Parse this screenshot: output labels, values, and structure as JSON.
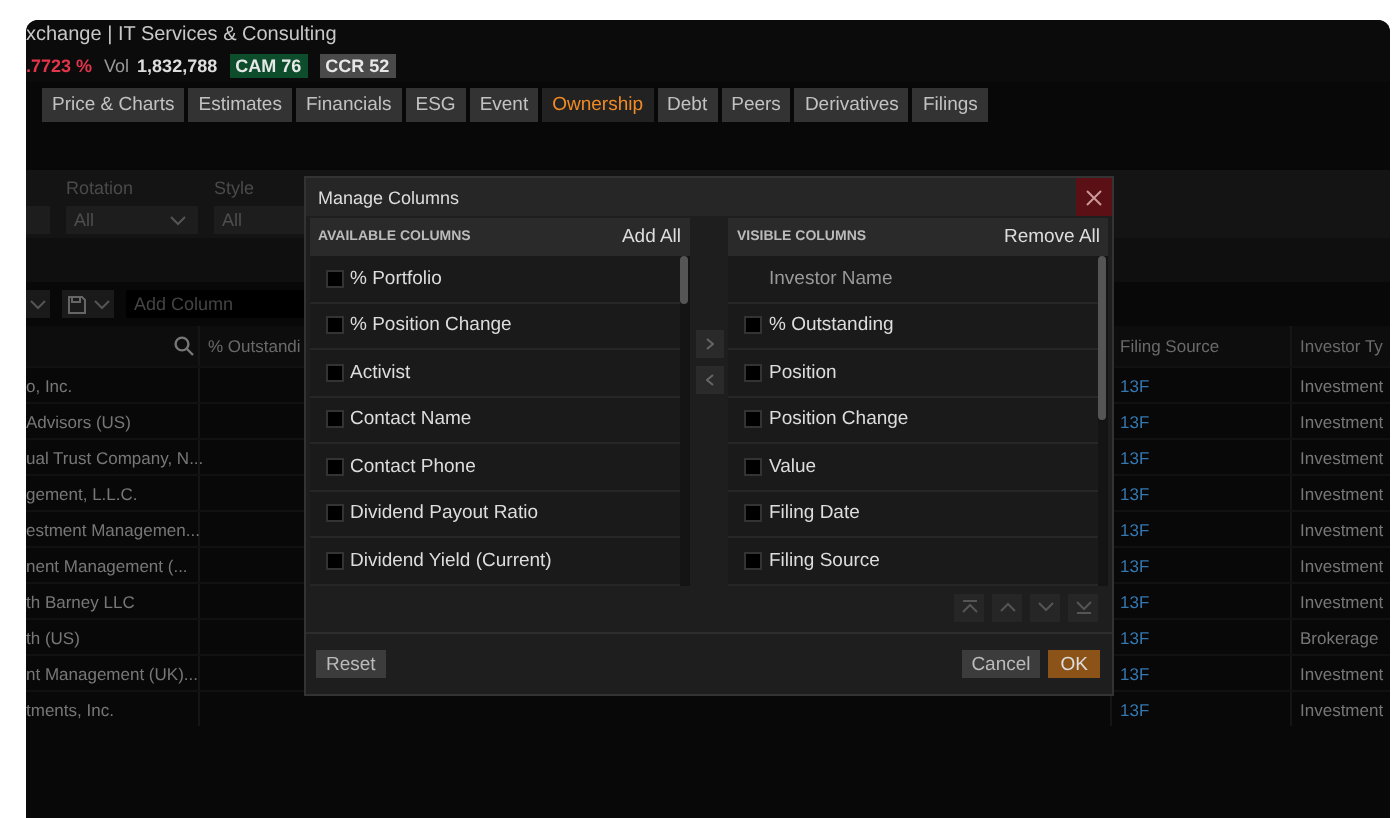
{
  "header": {
    "subtitle": "xchange | IT Services & Consulting",
    "change": ".7723 %",
    "volume_label": "Vol",
    "volume": "1,832,788",
    "badges": [
      {
        "label": "CAM 76",
        "color": "#0e4d2c"
      },
      {
        "label": "CCR 52",
        "color": "#4a4a4a"
      }
    ]
  },
  "tabs": [
    {
      "label": "Price & Charts",
      "selected": false
    },
    {
      "label": "Estimates",
      "selected": false
    },
    {
      "label": "Financials",
      "selected": false
    },
    {
      "label": "ESG",
      "selected": false
    },
    {
      "label": "Event",
      "selected": false
    },
    {
      "label": "Ownership",
      "selected": true
    },
    {
      "label": "Debt",
      "selected": false
    },
    {
      "label": "Peers",
      "selected": false
    },
    {
      "label": "Derivatives",
      "selected": false
    },
    {
      "label": "Filings",
      "selected": false
    }
  ],
  "filters": [
    {
      "label": "Rotation",
      "value": "All"
    },
    {
      "label": "Style",
      "value": "All"
    }
  ],
  "toolbar": {
    "add_column_placeholder": "Add Column"
  },
  "table": {
    "columns": [
      "% Outstandi",
      "Filing Source",
      "Investor Ty"
    ],
    "rows": [
      {
        "name": "o, Inc.",
        "filing_source": "13F",
        "investor_type": "Investment"
      },
      {
        "name": "Advisors (US)",
        "filing_source": "13F",
        "investor_type": "Investment"
      },
      {
        "name": "ual Trust Company, N...",
        "filing_source": "13F",
        "investor_type": "Investment"
      },
      {
        "name": "gement, L.L.C.",
        "filing_source": "13F",
        "investor_type": "Investment"
      },
      {
        "name": "estment Managemen...",
        "filing_source": "13F",
        "investor_type": "Investment"
      },
      {
        "name": "nent Management (...",
        "filing_source": "13F",
        "investor_type": "Investment"
      },
      {
        "name": "th Barney LLC",
        "filing_source": "13F",
        "investor_type": "Investment"
      },
      {
        "name": "th (US)",
        "filing_source": "13F",
        "investor_type": "Brokerage"
      },
      {
        "name": "nt Management (UK)...",
        "filing_source": "13F",
        "investor_type": "Investment"
      },
      {
        "name": "tments, Inc.",
        "filing_source": "13F",
        "investor_type": "Investment"
      }
    ]
  },
  "dialog": {
    "title": "Manage Columns",
    "available": {
      "heading": "AVAILABLE COLUMNS",
      "action": "Add All",
      "items": [
        {
          "kind": "checkbox",
          "label": "% Portfolio",
          "checked": false
        },
        {
          "kind": "checkbox",
          "label": "% Position Change",
          "checked": false
        },
        {
          "kind": "checkbox",
          "label": "Activist",
          "checked": false
        },
        {
          "kind": "checkbox",
          "label": "Contact Name",
          "checked": false
        },
        {
          "kind": "checkbox",
          "label": "Contact Phone",
          "checked": false
        },
        {
          "kind": "checkbox",
          "label": "Dividend Payout Ratio",
          "checked": false
        },
        {
          "kind": "checkbox",
          "label": "Dividend Yield (Current)",
          "checked": false
        }
      ]
    },
    "visible": {
      "heading": "VISIBLE COLUMNS",
      "action": "Remove All",
      "items": [
        {
          "kind": "fixed",
          "label": "Investor Name"
        },
        {
          "kind": "checkbox",
          "label": "% Outstanding",
          "checked": false
        },
        {
          "kind": "checkbox",
          "label": "Position",
          "checked": false
        },
        {
          "kind": "checkbox",
          "label": "Position Change",
          "checked": false
        },
        {
          "kind": "checkbox",
          "label": "Value",
          "checked": false
        },
        {
          "kind": "checkbox",
          "label": "Filing Date",
          "checked": false
        },
        {
          "kind": "checkbox",
          "label": "Filing Source",
          "checked": false
        }
      ]
    },
    "buttons": {
      "reset": "Reset",
      "cancel": "Cancel",
      "ok": "OK"
    }
  }
}
